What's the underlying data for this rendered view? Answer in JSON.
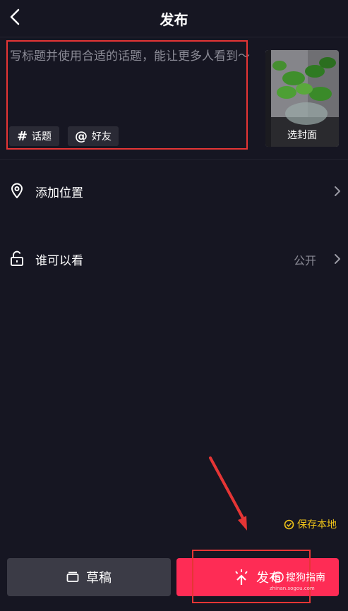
{
  "header": {
    "title": "发布"
  },
  "caption": {
    "placeholder": "写标题并使用合适的话题，能让更多人看到～",
    "chips": [
      {
        "label": "话题",
        "symbol": "#"
      },
      {
        "label": "好友",
        "symbol": "@"
      }
    ]
  },
  "cover": {
    "label": "选封面"
  },
  "rows": {
    "location": {
      "label": "添加位置"
    },
    "visibility": {
      "label": "谁可以看",
      "value": "公开"
    }
  },
  "save_local": {
    "label": "保存本地"
  },
  "buttons": {
    "draft": "草稿",
    "publish": "发布"
  },
  "watermark": {
    "text": "搜狗指南",
    "url": "zhinan.sogou.com"
  },
  "colors": {
    "accent": "#fe2c55",
    "save": "#f0c419",
    "background": "#161622",
    "annotation": "#e53535"
  }
}
